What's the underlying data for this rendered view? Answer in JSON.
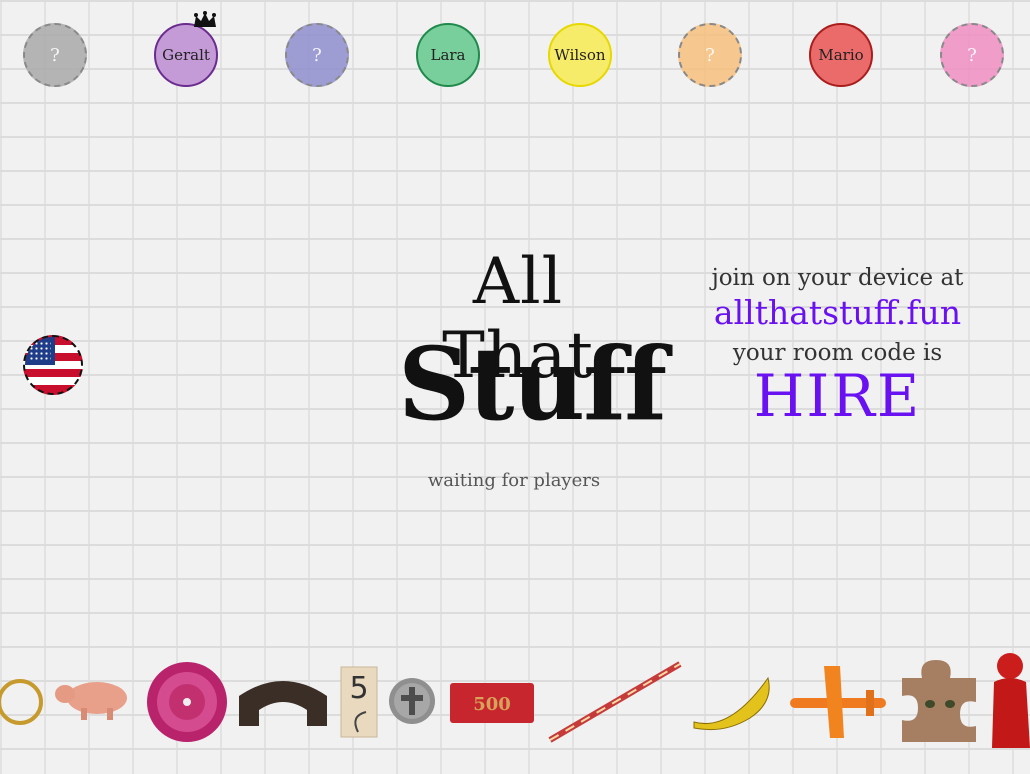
{
  "players": [
    {
      "name": "?",
      "filled": false,
      "color": "#aaaaaa"
    },
    {
      "name": "Geralt",
      "filled": true,
      "color": "#c49bd6",
      "border": "#6a2c8f",
      "host": true
    },
    {
      "name": "?",
      "filled": false,
      "color": "#8f8fcf"
    },
    {
      "name": "Lara",
      "filled": true,
      "color": "#79cf9b",
      "border": "#1f8a4c"
    },
    {
      "name": "Wilson",
      "filled": true,
      "color": "#f7ec6a",
      "border": "#e6d800"
    },
    {
      "name": "?",
      "filled": false,
      "color": "#f7c07d"
    },
    {
      "name": "Mario",
      "filled": true,
      "color": "#eb6b6b",
      "border": "#a91d1d"
    },
    {
      "name": "?",
      "filled": false,
      "color": "#f08fc4"
    }
  ],
  "language_icon": "us-flag-icon",
  "title": {
    "line1": "All That",
    "line2": "Stuff"
  },
  "status": "waiting for players",
  "join": {
    "line1": "join on your device at",
    "url": "allthatstuff.fun",
    "line3": "your room code is",
    "code": "HIRE"
  },
  "accent_color": "#6a11f2",
  "items": [
    "ring",
    "pig",
    "pink-flower",
    "arch-block",
    "number-tile",
    "cross-coin",
    "500-note",
    "stick",
    "banana",
    "toy-airplane",
    "cat-puzzle-piece",
    "red-figurine"
  ]
}
